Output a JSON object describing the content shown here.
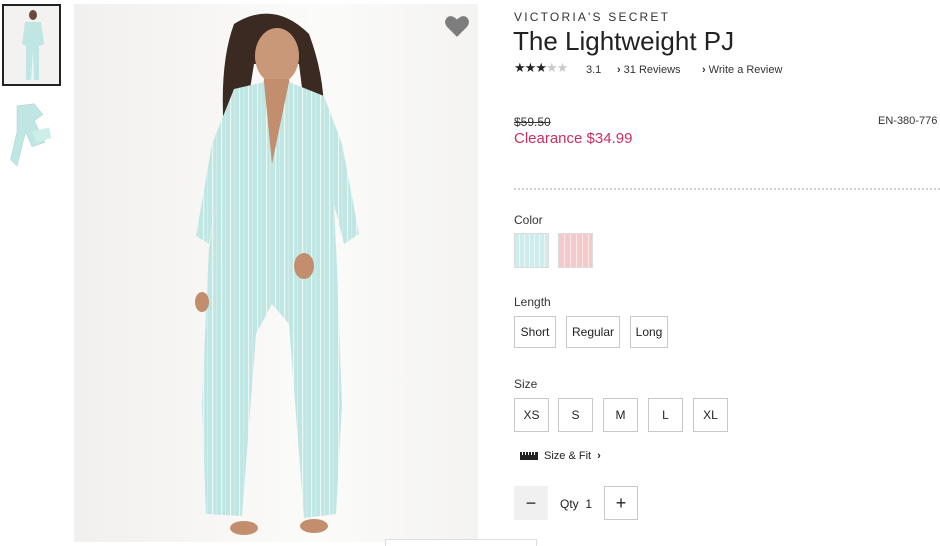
{
  "product": {
    "brand": "VICTORIA'S SECRET",
    "title": "The Lightweight PJ",
    "rating": "3.1",
    "rating_stars_filled": 3,
    "rating_stars_total": 5,
    "reviews_link": "31 Reviews",
    "write_review_link": "Write a Review",
    "original_price": "$59.50",
    "clearance_price": "Clearance $34.99",
    "sku": "EN-380-776"
  },
  "options": {
    "color_label": "Color",
    "colors": [
      "#cfecec",
      "#f3c9cf"
    ],
    "length_label": "Length",
    "lengths": [
      "Short",
      "Regular",
      "Long"
    ],
    "size_label": "Size",
    "sizes": [
      "XS",
      "S",
      "M",
      "L",
      "XL"
    ],
    "size_fit_link": "Size & Fit"
  },
  "quantity": {
    "minus": "−",
    "label": "Qty",
    "value": "1",
    "plus": "+"
  },
  "colors": {
    "sale": "#cc2e5d",
    "pajama": "#bfe6e2"
  },
  "icons": {
    "wishlist": "heart-icon"
  }
}
